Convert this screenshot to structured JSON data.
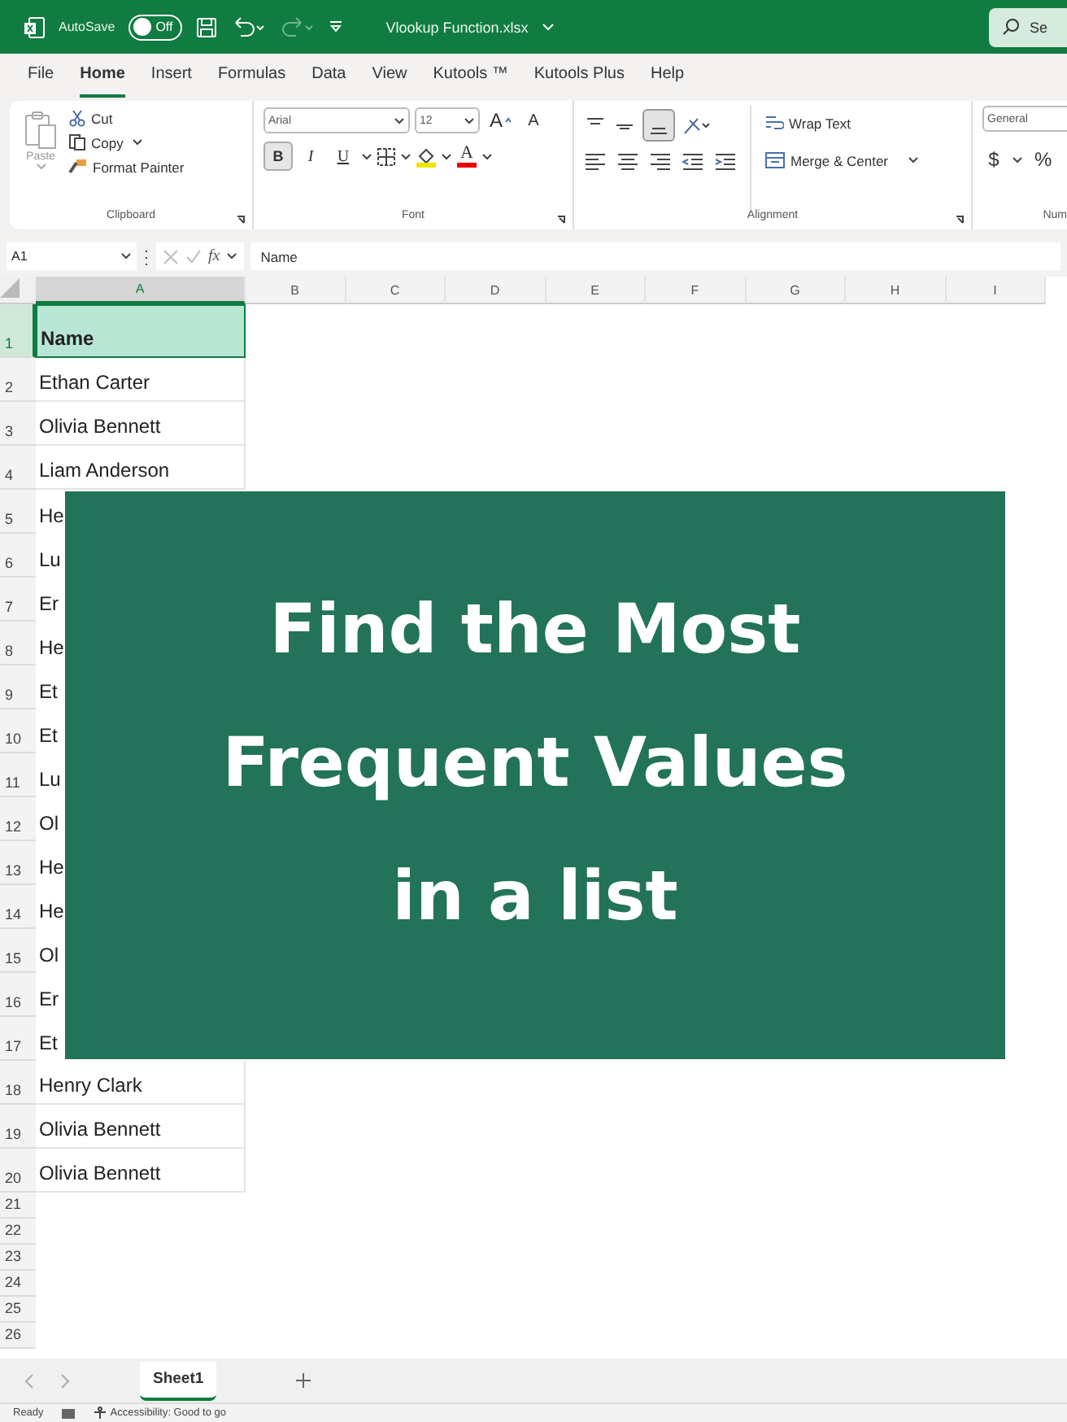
{
  "title_bar": {
    "autosave_label": "AutoSave",
    "autosave": {
      "label": "Off",
      "on": false
    },
    "redo_disabled": true,
    "file_name": "Vlookup Function.xlsx",
    "search": {
      "placeholder": "Se"
    }
  },
  "menu": [
    {
      "label": "File",
      "selected": false
    },
    {
      "label": "Home",
      "selected": true
    },
    {
      "label": "Insert",
      "selected": false
    },
    {
      "label": "Formulas",
      "selected": false
    },
    {
      "label": "Data",
      "selected": false
    },
    {
      "label": "View",
      "selected": false
    },
    {
      "label": "Kutools ™",
      "selected": false
    },
    {
      "label": "Kutools Plus",
      "selected": false
    },
    {
      "label": "Help",
      "selected": false
    }
  ],
  "ribbon": {
    "clipboard": {
      "paste": {
        "label": "Paste",
        "disabled": true
      },
      "cut": "Cut",
      "copy": "Copy",
      "format_painter": "Format Painter",
      "label": "Clipboard"
    },
    "font": {
      "font_name": "Arial",
      "font_size": "12",
      "grow": "A",
      "shrink": "A",
      "bold": {
        "label": "B",
        "selected": true
      },
      "italic": {
        "label": "I",
        "selected": false
      },
      "underline": {
        "label": "U",
        "selected": false
      },
      "font_color": "A",
      "label": "Font"
    },
    "alignment": {
      "bottom_align": {
        "selected": true
      },
      "wrap_text": "Wrap Text",
      "merge_center": "Merge & Center",
      "label": "Alignment"
    },
    "number": {
      "format": "General",
      "currency": "$",
      "percent": "%",
      "label": "Num"
    }
  },
  "formula_bar": {
    "name_box": "A1",
    "fx": "fx",
    "formula": "Name"
  },
  "sheet": {
    "columns": [
      {
        "label": "A",
        "selected": true
      },
      {
        "label": "B",
        "selected": false
      },
      {
        "label": "C",
        "selected": false
      },
      {
        "label": "D",
        "selected": false
      },
      {
        "label": "E",
        "selected": false
      },
      {
        "label": "F",
        "selected": false
      },
      {
        "label": "G",
        "selected": false
      },
      {
        "label": "H",
        "selected": false
      },
      {
        "label": "I",
        "selected": false
      }
    ],
    "rows": [
      {
        "label": "1",
        "cell": "Name",
        "selected": true
      },
      {
        "label": "2",
        "cell": "Ethan Carter",
        "selected": false
      },
      {
        "label": "3",
        "cell": "Olivia Bennett",
        "selected": false
      },
      {
        "label": "4",
        "cell": "Liam Anderson",
        "selected": false
      },
      {
        "label": "5",
        "cell": "He",
        "selected": false
      },
      {
        "label": "6",
        "cell": "Lu",
        "selected": false
      },
      {
        "label": "7",
        "cell": "Er",
        "selected": false
      },
      {
        "label": "8",
        "cell": "He",
        "selected": false
      },
      {
        "label": "9",
        "cell": "Et",
        "selected": false
      },
      {
        "label": "10",
        "cell": "Et",
        "selected": false
      },
      {
        "label": "11",
        "cell": "Lu",
        "selected": false
      },
      {
        "label": "12",
        "cell": "Ol",
        "selected": false
      },
      {
        "label": "13",
        "cell": "He",
        "selected": false
      },
      {
        "label": "14",
        "cell": "He",
        "selected": false
      },
      {
        "label": "15",
        "cell": "Ol",
        "selected": false
      },
      {
        "label": "16",
        "cell": "Er",
        "selected": false
      },
      {
        "label": "17",
        "cell": "Et",
        "selected": false
      },
      {
        "label": "18",
        "cell": "Henry Clark",
        "selected": false
      },
      {
        "label": "19",
        "cell": "Olivia Bennett",
        "selected": false
      },
      {
        "label": "20",
        "cell": "Olivia Bennett",
        "selected": false
      }
    ],
    "empty_rows": [
      "21",
      "22",
      "23",
      "24",
      "25",
      "26"
    ]
  },
  "overlay": {
    "lines": [
      "Find the Most",
      "Frequent Values",
      "in a list"
    ]
  },
  "sheet_tabs": [
    {
      "label": "Sheet1",
      "selected": true
    }
  ],
  "status_bar": {
    "status": "Ready",
    "accessibility": "Accessibility: Good to go"
  }
}
